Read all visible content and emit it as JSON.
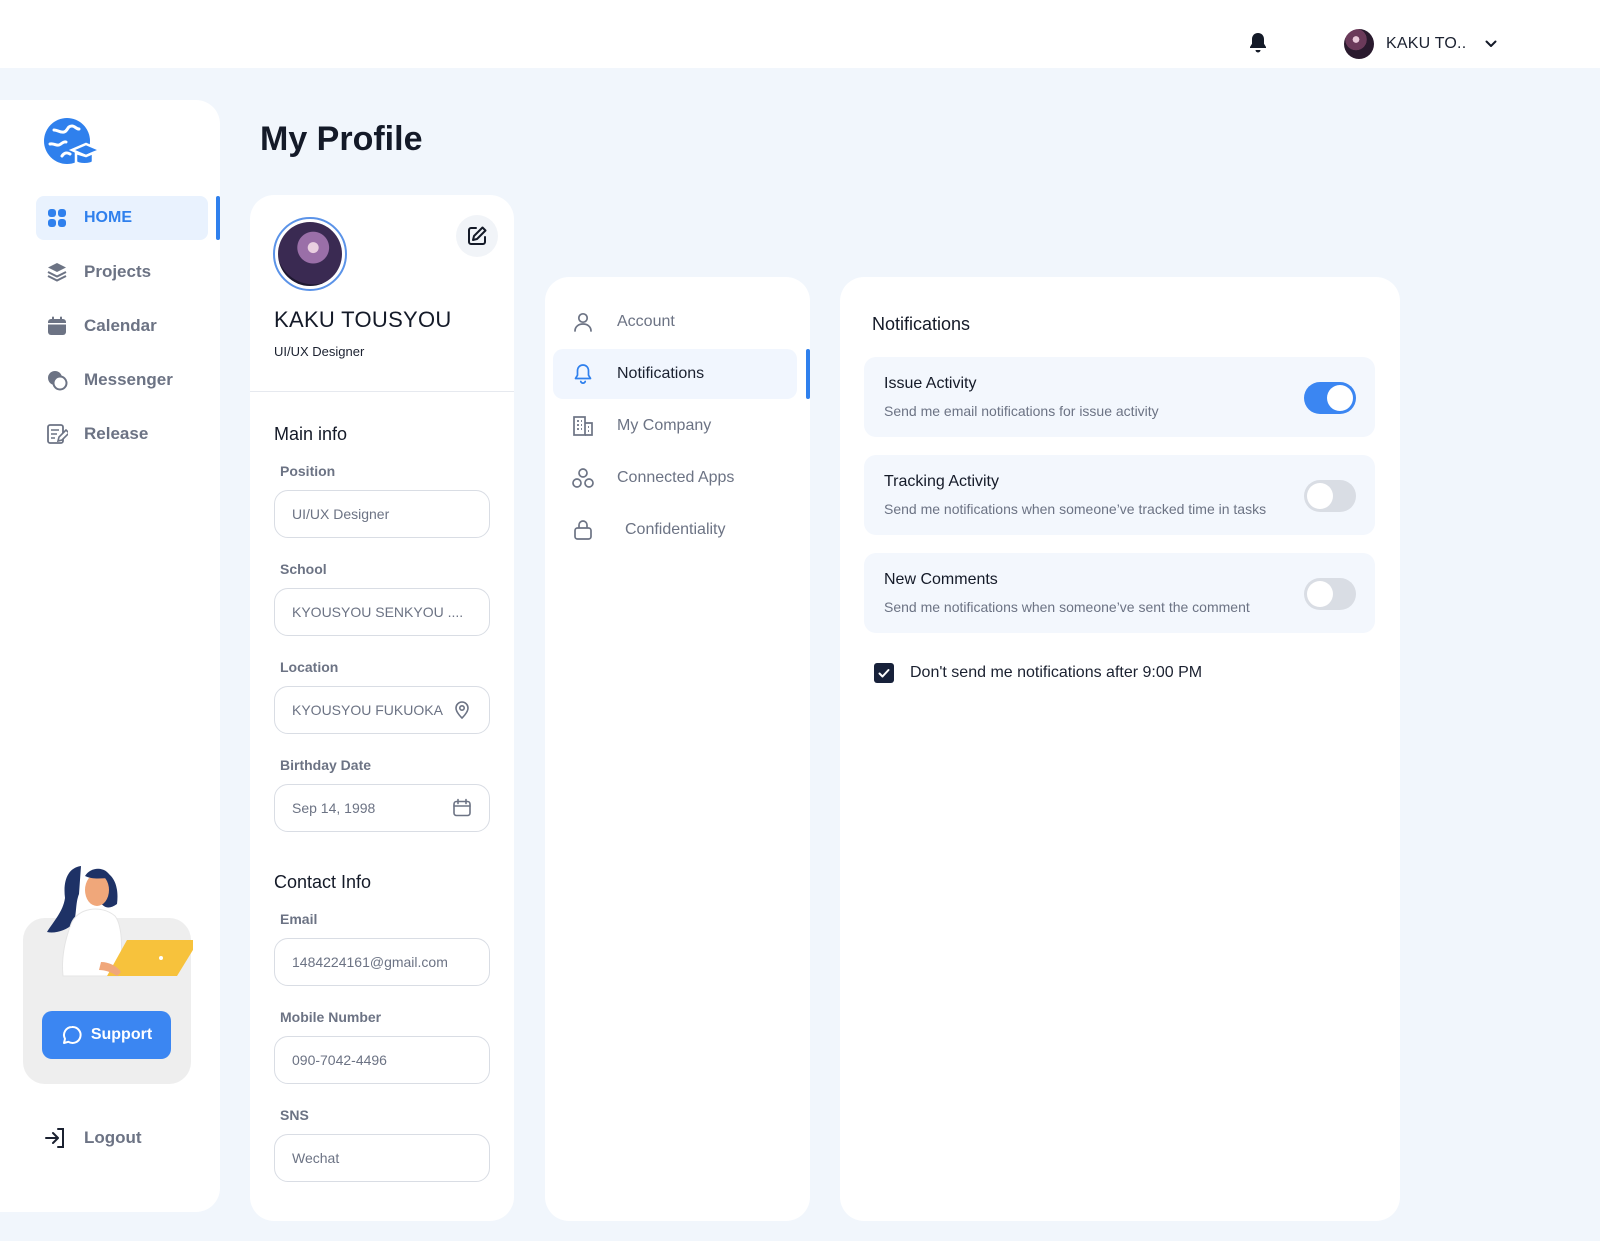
{
  "header": {
    "username": "KAKU TO..",
    "icons": {
      "notifications": "bell-icon",
      "menu": "chevron-down-icon"
    }
  },
  "sidebar": {
    "logo_icon": "globe-graduation-cap-icon",
    "items": [
      {
        "label": "HOME",
        "icon": "grid-icon",
        "active": true
      },
      {
        "label": "Projects",
        "icon": "layers-icon",
        "active": false
      },
      {
        "label": "Calendar",
        "icon": "calendar-icon",
        "active": false
      },
      {
        "label": "Messenger",
        "icon": "chat-bubbles-icon",
        "active": false
      },
      {
        "label": "Release",
        "icon": "edit-document-icon",
        "active": false
      }
    ],
    "support_label": "Support",
    "logout_label": "Logout"
  },
  "page": {
    "title": "My Profile"
  },
  "profile": {
    "name": "KAKU TOUSYOU",
    "role": "UI/UX Designer",
    "main_info_title": "Main info",
    "contact_info_title": "Contact Info",
    "fields": {
      "position": {
        "label": "Position",
        "value": "UI/UX Designer"
      },
      "school": {
        "label": "School",
        "value": "KYOUSYOU SENKYOU ...."
      },
      "location": {
        "label": "Location",
        "value": "KYOUSYOU FUKUOKA"
      },
      "birthday": {
        "label": "Birthday Date",
        "value": "Sep 14, 1998"
      },
      "email": {
        "label": "Email",
        "value": "1484224161@gmail.com"
      },
      "mobile": {
        "label": "Mobile Number",
        "value": "090-7042-4496"
      },
      "sns": {
        "label": "SNS",
        "value": "Wechat"
      }
    }
  },
  "settings_nav": {
    "items": [
      {
        "label": "Account",
        "icon": "user-icon",
        "active": false
      },
      {
        "label": "Notifications",
        "icon": "bell-icon",
        "active": true
      },
      {
        "label": "My Company",
        "icon": "building-icon",
        "active": false
      },
      {
        "label": "Connected Apps",
        "icon": "apps-icon",
        "active": false
      },
      {
        "label": "Confidentiality",
        "icon": "lock-icon",
        "active": false
      }
    ]
  },
  "notifications": {
    "title": "Notifications",
    "items": [
      {
        "title": "Issue Activity",
        "description": "Send me email notifications for issue activity",
        "enabled": true
      },
      {
        "title": "Tracking Activity",
        "description": "Send me notifications when someone’ve tracked time in tasks",
        "enabled": false
      },
      {
        "title": "New Comments",
        "description": "Send me notifications when someone’ve sent the comment",
        "enabled": false
      }
    ],
    "quiet_hours": {
      "label": "Don't send me notifications after 9:00 PM",
      "checked": true
    }
  },
  "colors": {
    "accent": "#2f80ed",
    "toggle_on": "#3b86f2",
    "background": "#f1f6fc",
    "text_muted": "#6c7384"
  }
}
